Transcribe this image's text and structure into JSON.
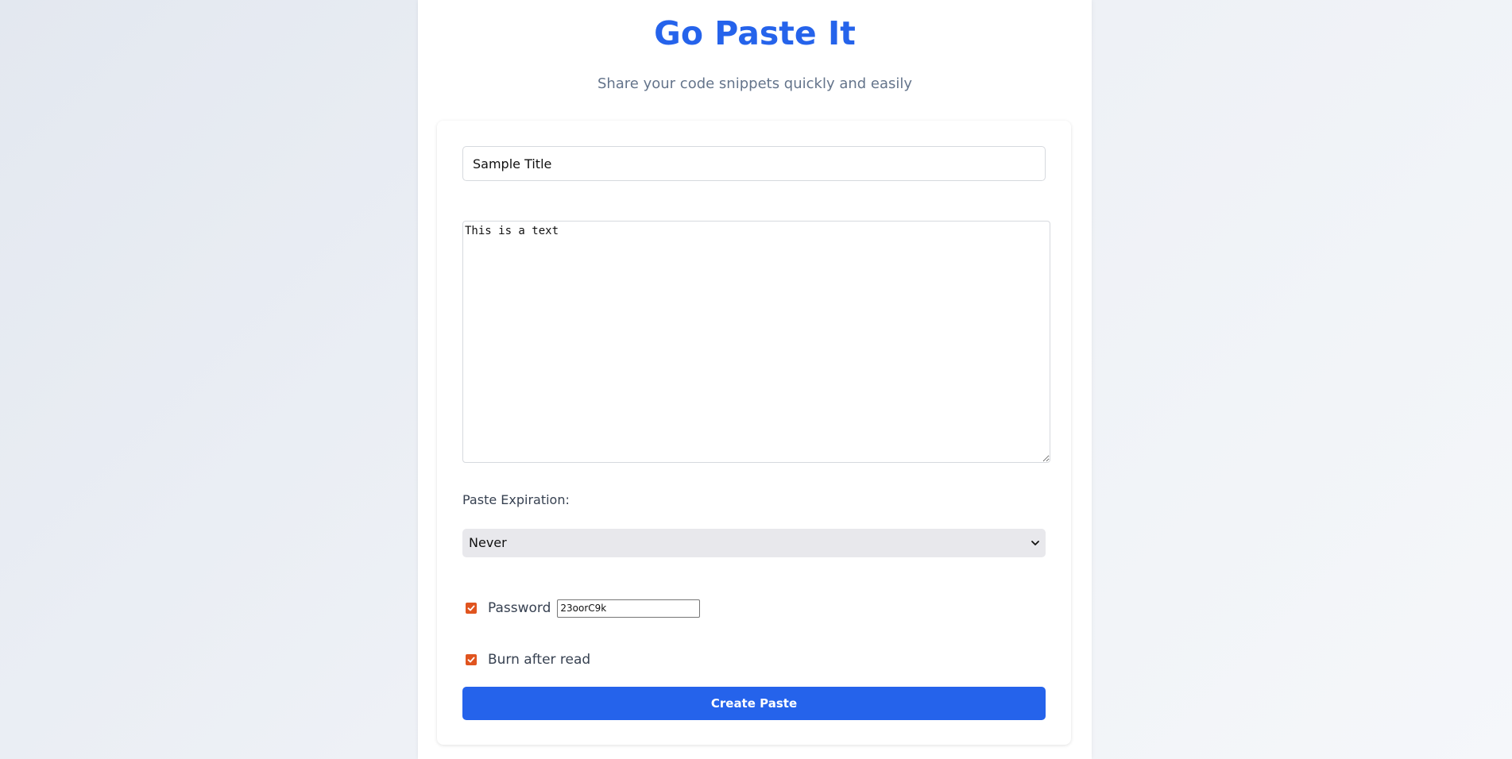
{
  "header": {
    "title": "Go Paste It",
    "subtitle": "Share your code snippets quickly and easily"
  },
  "form": {
    "title_value": "Sample Title",
    "content_value": "This is a text",
    "expiration_label": "Paste Expiration:",
    "expiration_selected": "Never",
    "password_checked": true,
    "password_label": "Password",
    "password_value": "23oorC9k",
    "burn_checked": true,
    "burn_label": "Burn after read",
    "submit_label": "Create Paste"
  },
  "colors": {
    "accent": "#2563eb",
    "checkbox": "#e0541f",
    "subtitle": "#64748b"
  },
  "icons": {
    "select_arrow": "chevron-down-icon",
    "checkbox_mark": "checkmark-icon"
  }
}
